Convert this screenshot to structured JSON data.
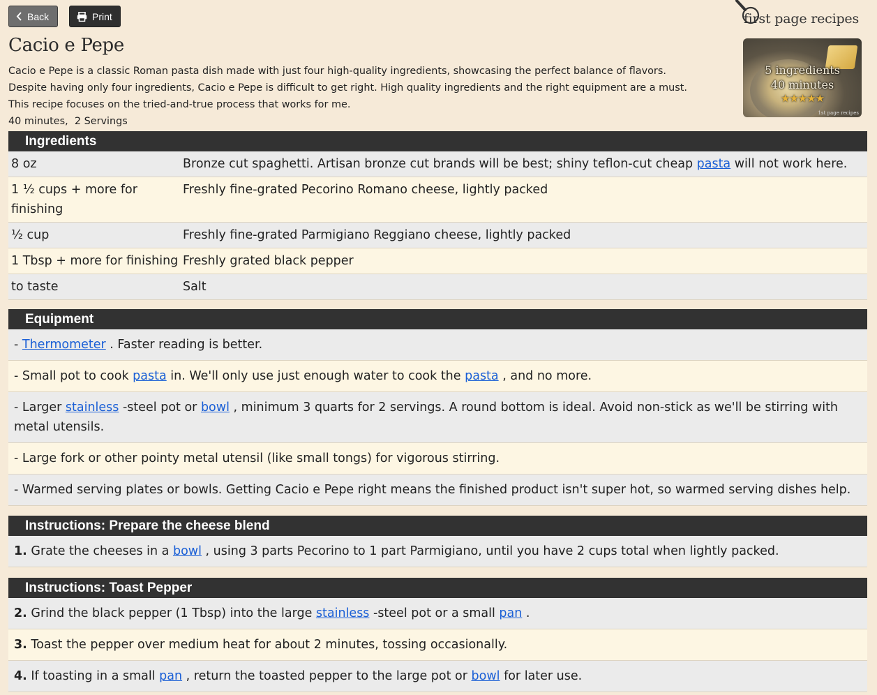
{
  "toolbar": {
    "back_label": "Back",
    "print_label": "Print"
  },
  "logo": {
    "text": "first page recipes"
  },
  "recipe": {
    "title": "Cacio e Pepe",
    "description": [
      "Cacio e Pepe is a classic Roman pasta dish made with just four high-quality ingredients, showcasing the perfect balance of flavors.",
      "Despite having only four ingredients, Cacio e Pepe is difficult to get right. High quality ingredients and the right equipment are a must.",
      "This recipe focuses on the tried-and-true process that works for me.",
      "40 minutes,  2 Servings"
    ],
    "hero": {
      "line1": "5 ingredients",
      "line2": "40 minutes",
      "stars": "★★★★★",
      "watermark": "1st page recipes"
    }
  },
  "ingredients": {
    "header": "Ingredients",
    "rows": [
      {
        "qty": "8 oz",
        "desc_before": "Bronze cut spaghetti. Artisan bronze cut brands will be best; shiny teflon-cut cheap ",
        "link": "pasta",
        "desc_after": " will not work here."
      },
      {
        "qty": "1 ½ cups + more for finishing",
        "desc_before": "Freshly fine-grated Pecorino Romano cheese, lightly packed",
        "link": "",
        "desc_after": ""
      },
      {
        "qty": "½ cup",
        "desc_before": "Freshly fine-grated Parmigiano Reggiano cheese, lightly packed",
        "link": "",
        "desc_after": ""
      },
      {
        "qty": "1 Tbsp + more for finishing",
        "desc_before": "Freshly grated black pepper",
        "link": "",
        "desc_after": ""
      },
      {
        "qty": "to taste",
        "desc_before": "Salt",
        "link": "",
        "desc_after": ""
      }
    ]
  },
  "equipment": {
    "header": "Equipment",
    "items": [
      {
        "prefix": "- ",
        "parts": [
          "",
          "Thermometer",
          " . Faster reading is better."
        ]
      },
      {
        "prefix": "- ",
        "parts": [
          "Small pot to cook ",
          "pasta",
          " in. We'll only use just enough water to cook the ",
          "pasta",
          " , and no more."
        ]
      },
      {
        "prefix": "- ",
        "parts": [
          "Larger ",
          "stainless",
          " -steel pot or ",
          "bowl",
          " , minimum 3 quarts for 2 servings. A round bottom is ideal. Avoid non-stick as we'll be stirring with metal utensils."
        ]
      },
      {
        "prefix": "- ",
        "parts": [
          "Large fork or other pointy metal utensil (like small tongs) for vigorous stirring."
        ]
      },
      {
        "prefix": "- ",
        "parts": [
          "Warmed serving plates or bowls. Getting Cacio e Pepe right means the finished product isn't super hot, so warmed serving dishes help."
        ]
      }
    ]
  },
  "instructions_cheese": {
    "header": "Instructions: Prepare the cheese blend",
    "steps": [
      {
        "num": "1.",
        "parts": [
          " Grate the cheeses in a ",
          "bowl",
          " , using 3 parts Pecorino to 1 part Parmigiano, until you have 2 cups total when lightly packed."
        ]
      }
    ]
  },
  "instructions_pepper": {
    "header": "Instructions: Toast Pepper",
    "steps": [
      {
        "num": "2.",
        "parts": [
          " Grind the black pepper (1 Tbsp) into the large ",
          "stainless",
          " -steel pot or a small ",
          "pan",
          " ."
        ]
      },
      {
        "num": "3.",
        "parts": [
          " Toast the pepper over medium heat for about 2 minutes, tossing occasionally."
        ]
      },
      {
        "num": "4.",
        "parts": [
          " If toasting in a small ",
          "pan",
          " , return the toasted pepper to the large pot or ",
          "bowl",
          " for later use."
        ]
      }
    ]
  }
}
